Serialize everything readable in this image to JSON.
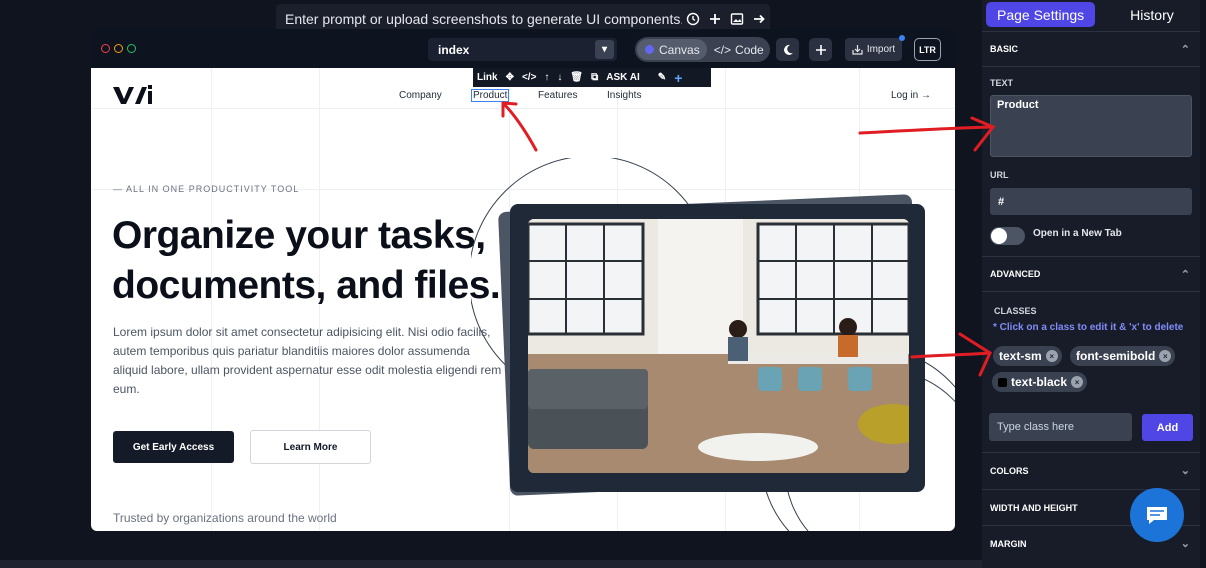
{
  "prompt_bar": {
    "placeholder": "Enter prompt or upload screenshots to generate UI components..."
  },
  "editor": {
    "page_name": "index",
    "modes": {
      "canvas": "Canvas",
      "code": "Code"
    },
    "import_label": "Import",
    "direction_label": "LTR",
    "window_dots": [
      "#ef4444",
      "#f59e0b",
      "#22c55e"
    ]
  },
  "element_toolbar": {
    "element_type": "Link",
    "ask_ai": "ASK AI"
  },
  "site": {
    "nav": {
      "items": [
        "Company",
        "Product",
        "Features",
        "Insights"
      ],
      "login": "Log in →"
    },
    "eyebrow": "— ALL IN ONE PRODUCTIVITY TOOL",
    "headline": "Organize your tasks, documents, and files.",
    "body": "Lorem ipsum dolor sit amet consectetur adipisicing elit. Nisi odio facilis, autem temporibus quis pariatur blanditiis maiores dolor assumenda aliquid labore, ullam provident aspernatur esse odit molestia eligendi rem eum.",
    "primary_cta": "Get Early Access",
    "secondary_cta": "Learn More",
    "trusted": "Trusted by organizations around the world"
  },
  "sidebar": {
    "tabs": {
      "active": "Page Settings",
      "other": "History"
    },
    "basic": "BASIC",
    "text_label": "TEXT",
    "text_value": "Product",
    "url_label": "URL",
    "url_value": "#",
    "new_tab_label": "Open in a New Tab",
    "advanced": "ADVANCED",
    "classes_label": "CLASSES",
    "classes_hint": "* Click on a class to edit it & 'x' to delete",
    "classes": [
      "text-sm",
      "font-semibold",
      "text-black"
    ],
    "class_placeholder": "Type class here",
    "add_label": "Add",
    "sections": [
      "COLORS",
      "WIDTH AND HEIGHT",
      "MARGIN"
    ]
  },
  "colors": {
    "accent": "#4f46e5",
    "annotation": "#e11d24",
    "chat": "#1d74d8"
  }
}
